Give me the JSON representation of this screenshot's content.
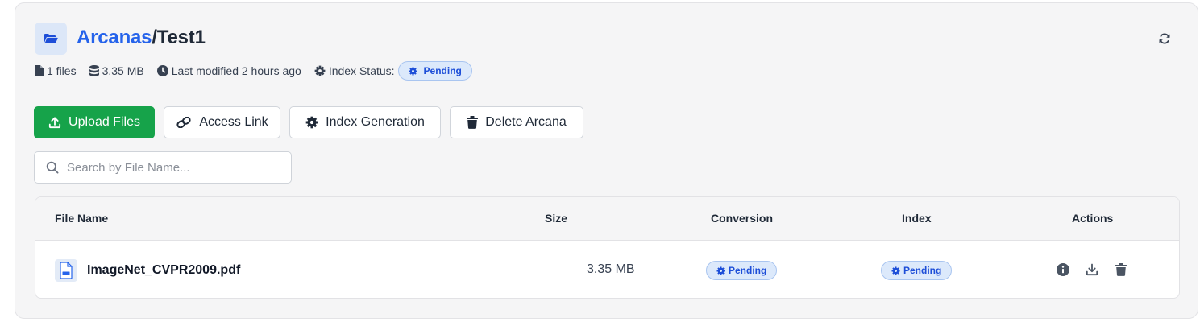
{
  "header": {
    "breadcrumb_parent": "Arcanas",
    "breadcrumb_separator": "/",
    "breadcrumb_current": "Test1",
    "folder_icon": "folder-open-icon",
    "refresh_icon": "refresh-icon"
  },
  "meta": {
    "file_count": "1 files",
    "total_size": "3.35 MB",
    "last_modified": "Last modified 2 hours ago",
    "index_status_label": "Index Status:",
    "index_status_value": "Pending"
  },
  "toolbar": {
    "upload_label": "Upload Files",
    "access_link_label": "Access Link",
    "index_generation_label": "Index Generation",
    "delete_label": "Delete Arcana"
  },
  "search": {
    "placeholder": "Search by File Name..."
  },
  "table": {
    "columns": [
      "File Name",
      "Size",
      "Conversion",
      "Index",
      "Actions"
    ],
    "rows": [
      {
        "file_name": "ImageNet_CVPR2009.pdf",
        "file_type": "PDF",
        "size": "3.35 MB",
        "conversion": "Pending",
        "index": "Pending",
        "actions": [
          "info-icon",
          "download-icon",
          "trash-icon"
        ]
      }
    ]
  },
  "colors": {
    "brand_link": "#2563eb",
    "primary_button": "#16a34a",
    "pending_badge_bg": "#dce9fb",
    "pending_badge_text": "#1d4ed8"
  }
}
